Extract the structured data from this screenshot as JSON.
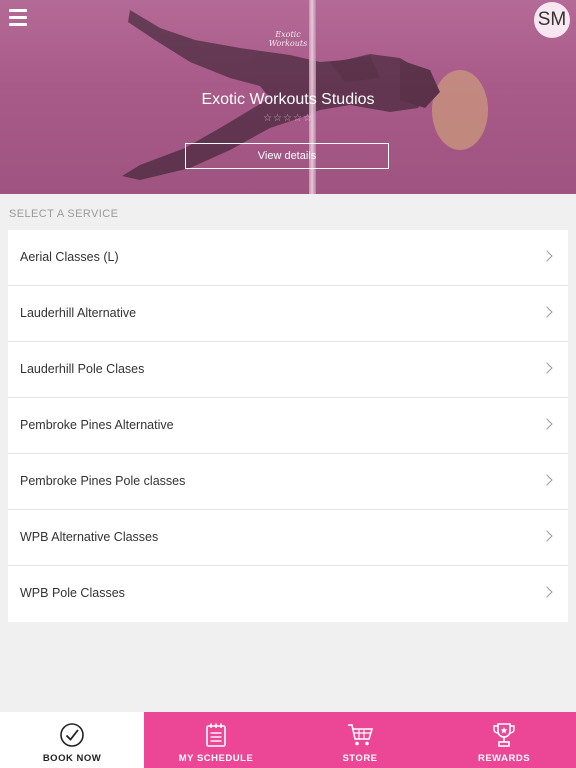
{
  "header": {
    "menu_icon": "hamburger-menu-icon",
    "avatar_initials": "SM",
    "logo_text": "Exotic Workouts",
    "studio_name": "Exotic Workouts Studios",
    "rating_stars": "☆☆☆☆☆",
    "view_details_label": "View details",
    "hero_color": "#a85a88"
  },
  "services": {
    "section_title": "SELECT A SERVICE",
    "items": [
      {
        "label": "Aerial Classes (L)"
      },
      {
        "label": "Lauderhill Alternative"
      },
      {
        "label": "Lauderhill Pole Clases"
      },
      {
        "label": "Pembroke Pines Alternative"
      },
      {
        "label": "Pembroke Pines Pole classes"
      },
      {
        "label": "WPB Alternative Classes"
      },
      {
        "label": "WPB Pole Classes"
      }
    ]
  },
  "tabbar": {
    "accent_color": "#ec4796",
    "tabs": [
      {
        "label": "BOOK NOW",
        "icon": "check-circle-icon",
        "active": true
      },
      {
        "label": "MY SCHEDULE",
        "icon": "calendar-icon",
        "active": false
      },
      {
        "label": "STORE",
        "icon": "shopping-cart-icon",
        "active": false
      },
      {
        "label": "REWARDS",
        "icon": "trophy-icon",
        "active": false
      }
    ]
  }
}
